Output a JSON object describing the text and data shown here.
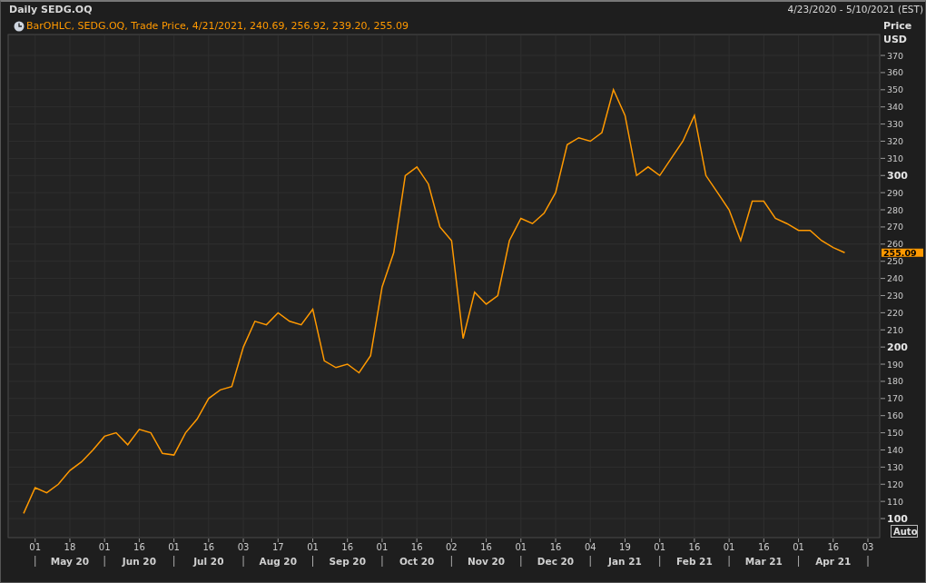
{
  "header": {
    "title": "Daily SEDG.OQ",
    "date_range": "4/23/2020 - 5/10/2021 (EST)"
  },
  "legend": {
    "text": "BarOHLC, SEDG.OQ, Trade Price, 4/21/2021, 240.69, 256.92, 239.20, 255.09"
  },
  "price_axis": {
    "title": "Price",
    "unit": "USD",
    "last_price": "255.09",
    "auto_button": "Auto"
  },
  "month_labels": [
    "May 20",
    "Jun 20",
    "Jul 20",
    "Aug 20",
    "Sep 20",
    "Oct 20",
    "Nov 20",
    "Dec 20",
    "Jan 21",
    "Feb 21",
    "Mar 21",
    "Apr 21"
  ],
  "chart_data": {
    "type": "line",
    "categories": [
      null,
      "01",
      null,
      null,
      "18",
      null,
      null,
      "01",
      null,
      null,
      "16",
      null,
      null,
      "01",
      null,
      null,
      "16",
      null,
      null,
      "03",
      null,
      null,
      "17",
      null,
      null,
      "01",
      null,
      null,
      "16",
      null,
      null,
      "01",
      null,
      null,
      "16",
      null,
      null,
      "02",
      null,
      null,
      "16",
      null,
      null,
      "01",
      null,
      null,
      "16",
      null,
      null,
      "04",
      null,
      null,
      "19",
      null,
      null,
      "01",
      null,
      null,
      "16",
      null,
      null,
      "01",
      null,
      null,
      "16",
      null,
      null,
      "01",
      null,
      null,
      "16",
      null,
      null,
      "03"
    ],
    "series": [
      {
        "color": "#ff9900",
        "values": [
          103,
          118,
          115,
          120,
          128,
          133,
          140,
          148,
          150,
          143,
          152,
          150,
          138,
          137,
          150,
          158,
          170,
          175,
          177,
          200,
          215,
          213,
          220,
          215,
          213,
          222,
          192,
          188,
          190,
          185,
          195,
          235,
          255,
          300,
          305,
          295,
          270,
          262,
          205,
          232,
          225,
          230,
          262,
          275,
          272,
          278,
          290,
          318,
          322,
          320,
          325,
          350,
          335,
          300,
          305,
          300,
          310,
          320,
          335,
          300,
          290,
          280,
          262,
          285,
          285,
          275,
          272,
          268,
          268,
          262,
          258,
          255,
          null,
          null
        ]
      }
    ],
    "grid": true,
    "ylim": [
      88.9,
      382.2
    ],
    "yticks": [
      100,
      110,
      120,
      130,
      140,
      150,
      160,
      170,
      180,
      190,
      200,
      210,
      220,
      230,
      240,
      250,
      260,
      270,
      280,
      290,
      300,
      310,
      320,
      330,
      340,
      350,
      360,
      370
    ]
  }
}
